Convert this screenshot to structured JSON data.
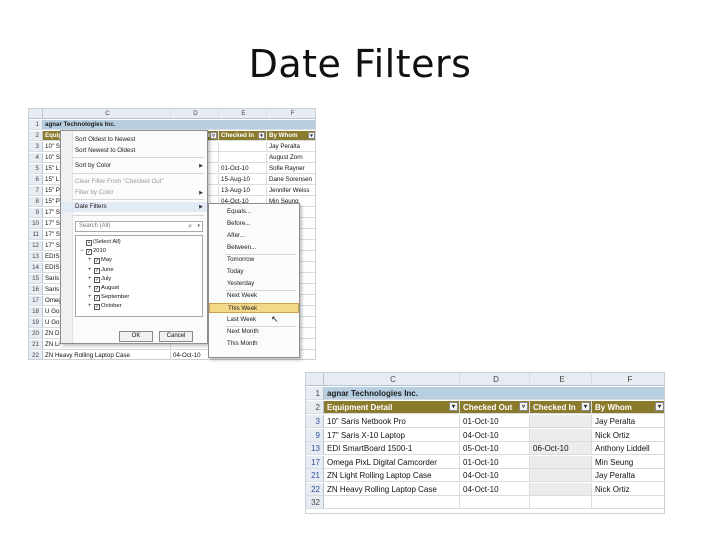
{
  "slide": {
    "title": "Date Filters"
  },
  "columns": [
    "C",
    "D",
    "E",
    "F"
  ],
  "top_sheet": {
    "company": "agnar Technologies Inc.",
    "headers": [
      "Equipment Detail",
      "Checked Out",
      "Checked In",
      "By Whom"
    ],
    "rows": [
      {
        "num": "1",
        "c": "agnar Technologies Inc.",
        "d": "",
        "e": "",
        "f": ""
      },
      {
        "num": "2",
        "c": "Equipment Detail",
        "d": "Checked Out",
        "e": "Checked In",
        "f": "By Whom"
      },
      {
        "num": "3",
        "c": "10\" S",
        "d": "",
        "e": "",
        "f": "Jay Peralta"
      },
      {
        "num": "4",
        "c": "10\" S",
        "d": "",
        "e": "",
        "f": "August Zorn"
      },
      {
        "num": "5",
        "c": "15\" L",
        "d": "",
        "e": "01-Oct-10",
        "f": "Sofie Rayner"
      },
      {
        "num": "6",
        "c": "15\" L",
        "d": "",
        "e": "15-Aug-10",
        "f": "Dane Sorensen"
      },
      {
        "num": "7",
        "c": "15\" P",
        "d": "",
        "e": "13-Aug-10",
        "f": "Jennifer Weiss"
      },
      {
        "num": "8",
        "c": "15\" P",
        "d": "",
        "e": "04-Oct-10",
        "f": "Min Seung"
      },
      {
        "num": "9",
        "c": "17\" S",
        "d": "",
        "e": "",
        "f": ""
      },
      {
        "num": "10",
        "c": "17\" S",
        "d": "",
        "e": "",
        "f": "er"
      },
      {
        "num": "11",
        "c": "17\" S",
        "d": "",
        "e": "",
        "f": "osta"
      },
      {
        "num": "12",
        "c": "17\" S",
        "d": "",
        "e": "",
        "f": ""
      },
      {
        "num": "13",
        "c": "EDIS",
        "d": "",
        "e": "",
        "f": "dell"
      },
      {
        "num": "14",
        "c": "EDIS",
        "d": "",
        "e": "",
        "f": ""
      },
      {
        "num": "15",
        "c": "Saris",
        "d": "",
        "e": "",
        "f": "yen"
      },
      {
        "num": "16",
        "c": "Saris",
        "d": "",
        "e": "",
        "f": ""
      },
      {
        "num": "17",
        "c": "Omeg",
        "d": "",
        "e": "",
        "f": ""
      },
      {
        "num": "18",
        "c": "U Go",
        "d": "",
        "e": "",
        "f": "on"
      },
      {
        "num": "19",
        "c": "U Go",
        "d": "",
        "e": "",
        "f": ""
      },
      {
        "num": "20",
        "c": "ZN D",
        "d": "",
        "e": "",
        "f": ""
      },
      {
        "num": "21",
        "c": "ZN Li",
        "d": "",
        "e": "",
        "f": ""
      },
      {
        "num": "22",
        "c": "ZN Heavy Rolling Laptop Case",
        "d": "04-Oct-10",
        "e": "",
        "f": ""
      }
    ]
  },
  "filter_menu": {
    "items": [
      {
        "label": "Sort Oldest to Newest",
        "disabled": false
      },
      {
        "label": "Sort Newest to Oldest",
        "disabled": false
      },
      {
        "label": "Sort by Color",
        "disabled": false,
        "arrow": "▶"
      },
      {
        "label": "Clear Filter From \"Checked Out\"",
        "disabled": true
      },
      {
        "label": "Filter by Color",
        "disabled": true,
        "arrow": "▶"
      },
      {
        "label": "Date Filters",
        "disabled": false,
        "arrow": "▶",
        "highlight": true
      }
    ],
    "search_placeholder": "Search (All)",
    "tree": [
      {
        "label": "(Select All)",
        "check": "▪",
        "indent": 0,
        "pm": ""
      },
      {
        "label": "2010",
        "check": "✓",
        "indent": 0,
        "pm": "−"
      },
      {
        "label": "May",
        "check": "✓",
        "indent": 1,
        "pm": "+"
      },
      {
        "label": "June",
        "check": "✓",
        "indent": 1,
        "pm": "+"
      },
      {
        "label": "July",
        "check": "✓",
        "indent": 1,
        "pm": "+"
      },
      {
        "label": "August",
        "check": "✓",
        "indent": 1,
        "pm": "+"
      },
      {
        "label": "September",
        "check": "✓",
        "indent": 1,
        "pm": "+"
      },
      {
        "label": "October",
        "check": "✓",
        "indent": 1,
        "pm": "+"
      }
    ],
    "ok": "OK",
    "cancel": "Cancel"
  },
  "date_submenu": {
    "items": [
      {
        "label": "Equals...",
        "sep_after": false
      },
      {
        "label": "Before...",
        "sep_after": false
      },
      {
        "label": "After...",
        "sep_after": false
      },
      {
        "label": "Between...",
        "sep_after": true
      },
      {
        "label": "Tomorrow",
        "sep_after": false
      },
      {
        "label": "Today",
        "sep_after": false
      },
      {
        "label": "Yesterday",
        "sep_after": true
      },
      {
        "label": "Next Week",
        "sep_after": false
      },
      {
        "label": "This Week",
        "sep_after": false,
        "selected": true
      },
      {
        "label": "Last Week",
        "sep_after": true
      },
      {
        "label": "Next Month",
        "sep_after": false
      },
      {
        "label": "This Month",
        "sep_after": false
      }
    ]
  },
  "bottom_sheet": {
    "company": "agnar Technologies Inc.",
    "headers": [
      "Equipment Detail",
      "Checked Out",
      "Checked In",
      "By Whom"
    ],
    "rows": [
      {
        "num": "3",
        "c": "10\" Saris Netbook Pro",
        "d": "01-Oct-10",
        "e": "",
        "f": "Jay Peralta"
      },
      {
        "num": "9",
        "c": "17\" Saris X-10 Laptop",
        "d": "04-Oct-10",
        "e": "",
        "f": "Nick Ortiz"
      },
      {
        "num": "13",
        "c": "EDI SmartBoard 1500-1",
        "d": "05-Oct-10",
        "e": "06-Oct-10",
        "f": "Anthony Liddell"
      },
      {
        "num": "17",
        "c": "Omega PixL Digital Camcorder",
        "d": "01-Oct-10",
        "e": "",
        "f": "Min Seung"
      },
      {
        "num": "21",
        "c": "ZN Light Rolling Laptop Case",
        "d": "04-Oct-10",
        "e": "",
        "f": "Jay Peralta"
      },
      {
        "num": "22",
        "c": "ZN Heavy Rolling Laptop Case",
        "d": "04-Oct-10",
        "e": "",
        "f": "Nick Ortiz"
      },
      {
        "num": "32",
        "c": "",
        "d": "",
        "e": "",
        "f": ""
      }
    ]
  },
  "icons": {
    "filter_dropdown": "▾",
    "filter_active": "▿",
    "search": "⌕",
    "dropdown": "▾",
    "cursor": "↖"
  }
}
